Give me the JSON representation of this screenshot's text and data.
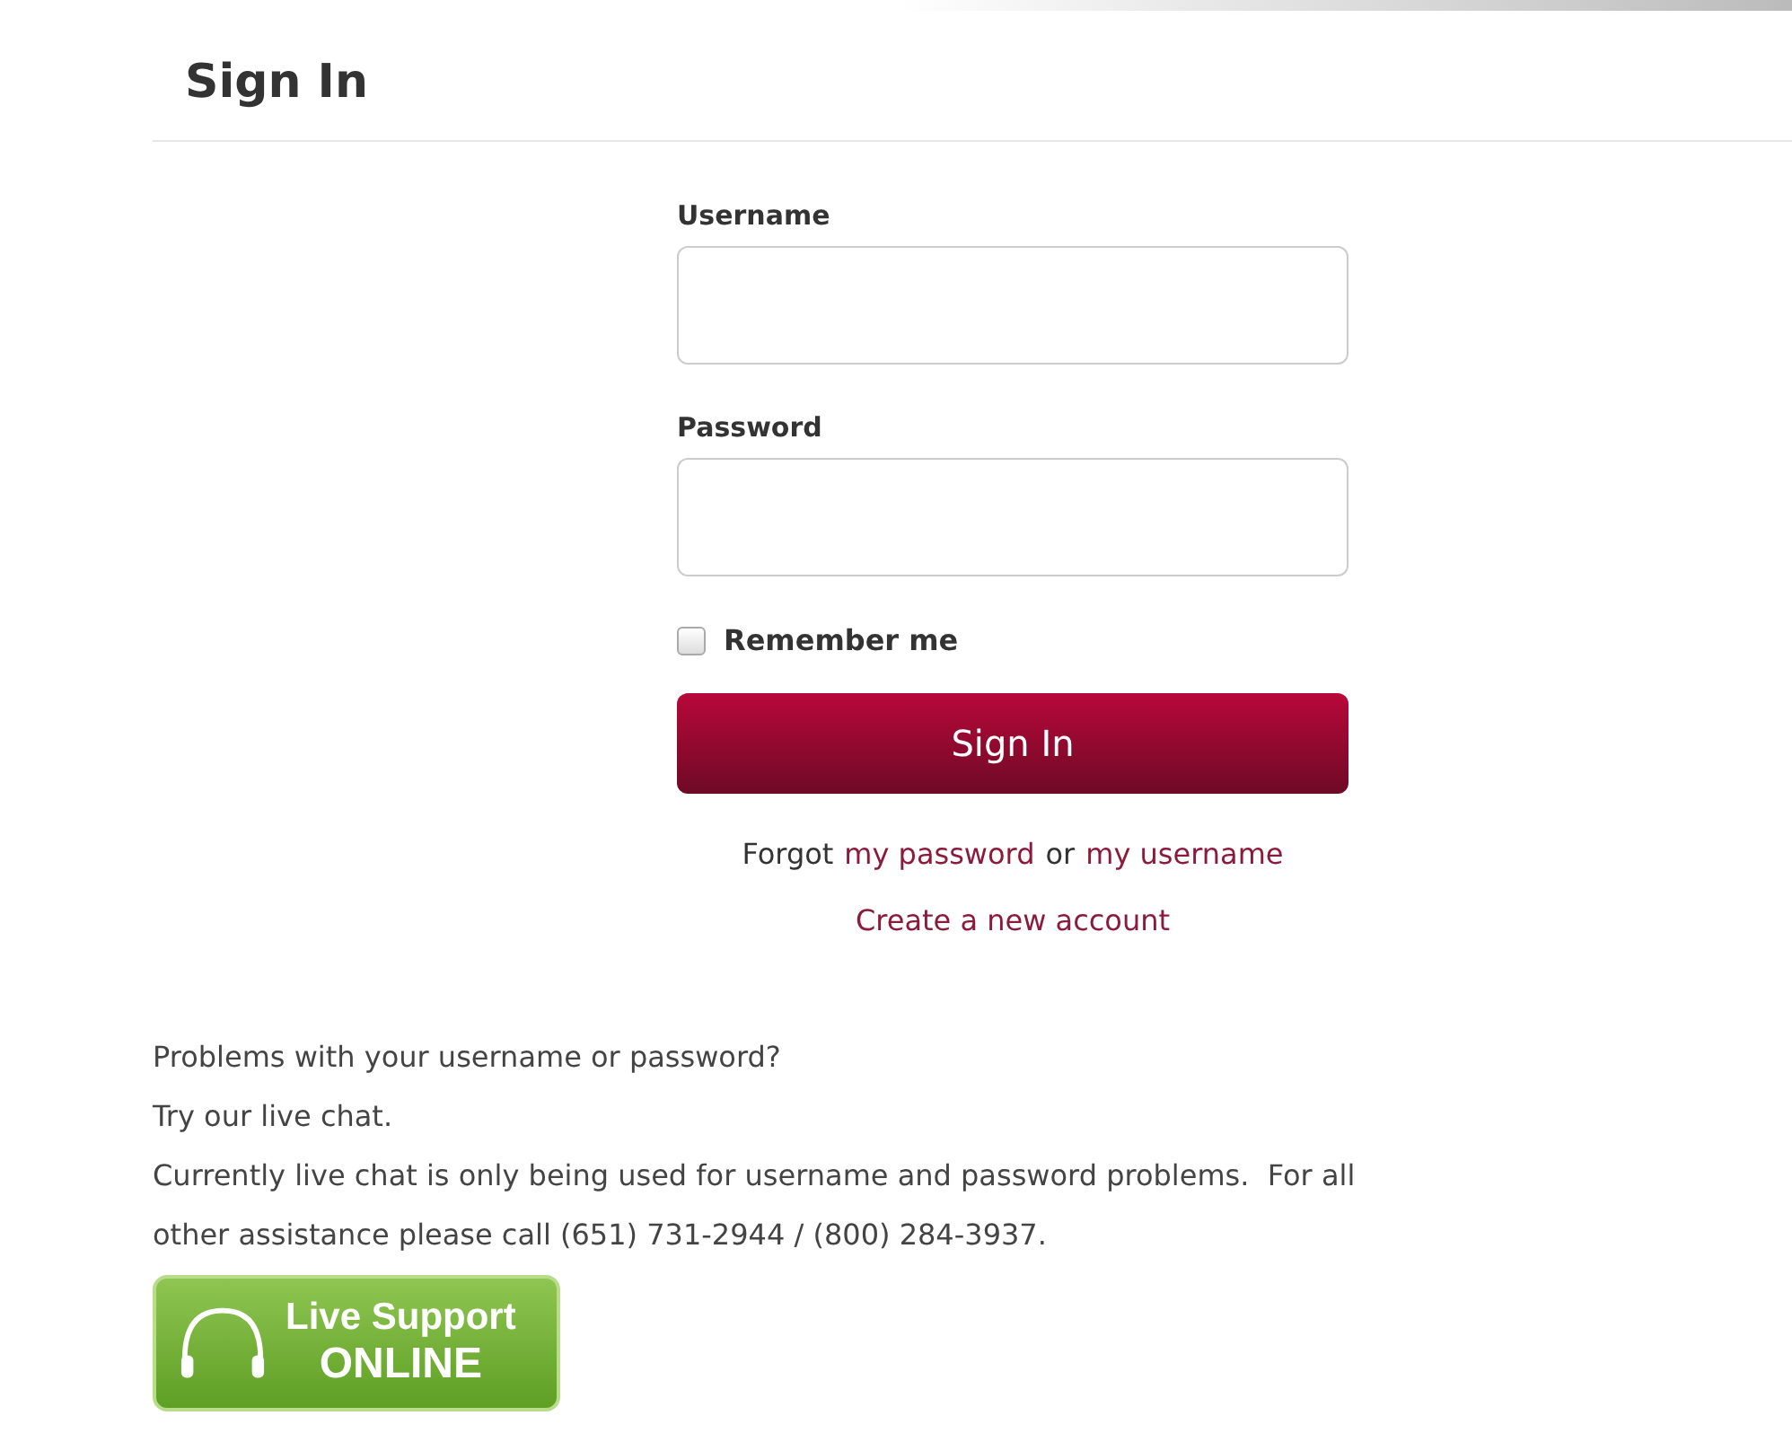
{
  "heading": "Sign In",
  "form": {
    "username_label": "Username",
    "password_label": "Password",
    "remember": {
      "label": "Remember me",
      "checked": false
    },
    "submit": "Sign In",
    "forgot": {
      "prefix": "Forgot",
      "password_link": "my password",
      "middle": "or",
      "username_link": "my username"
    },
    "create_link": "Create a new account"
  },
  "help": [
    "Problems with your username or password?",
    "Try our live chat.",
    "Currently live chat is only being used for username and password problems.  For all other assistance please call (651) 731-2944 / (800) 284-3937."
  ],
  "live_support": {
    "line_1": "Live Support",
    "line_2": "ONLINE"
  }
}
